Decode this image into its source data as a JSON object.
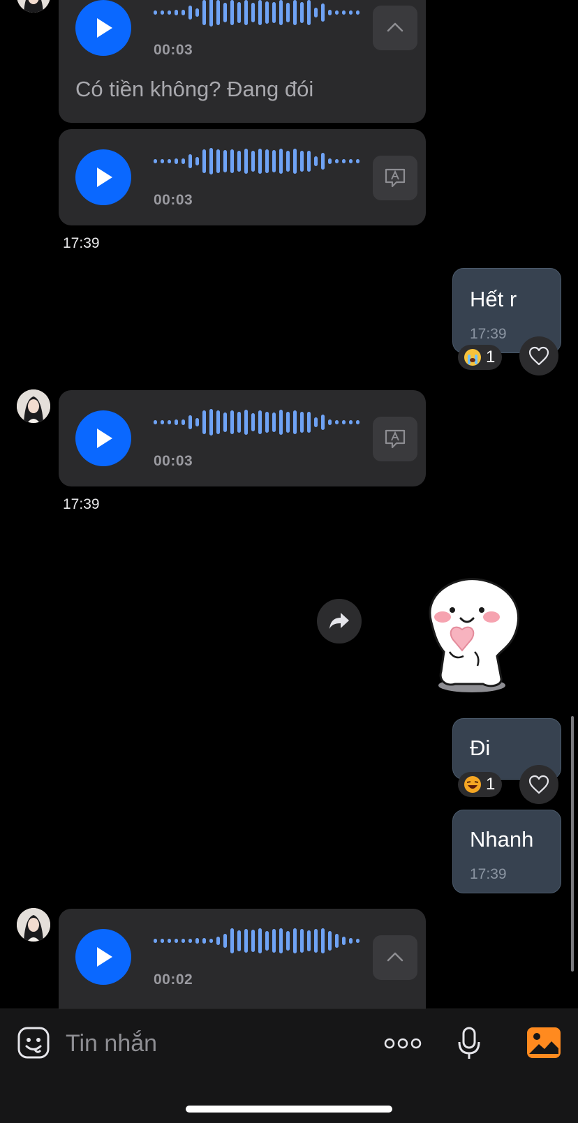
{
  "messages": [
    {
      "type": "voice-in",
      "duration": "00:03",
      "transcript": "Có tiền không? Đang đói",
      "action_icon": "chevron-up-icon"
    },
    {
      "type": "voice-in",
      "duration": "00:03",
      "action_icon": "transcribe-icon"
    },
    {
      "type": "time",
      "value": "17:39"
    },
    {
      "type": "text-out",
      "text": "Hết r",
      "time": "17:39",
      "reaction": {
        "emoji": "crying-face",
        "count": "1"
      }
    },
    {
      "type": "voice-in",
      "duration": "00:03",
      "action_icon": "transcribe-icon"
    },
    {
      "type": "time",
      "value": "17:39"
    },
    {
      "type": "sticker-out",
      "sticker": "white-mascot-holding-heart"
    },
    {
      "type": "text-out",
      "text": "Đi",
      "reaction": {
        "emoji": "laughing-face",
        "count": "1"
      }
    },
    {
      "type": "text-out",
      "text": "Nhanh",
      "time": "17:39"
    },
    {
      "type": "voice-in",
      "duration": "00:02",
      "action_icon": "chevron-up-icon"
    }
  ],
  "composer": {
    "placeholder": "Tin nhắn",
    "icons": [
      "sticker-icon",
      "more-icon",
      "microphone-icon",
      "photo-icon"
    ]
  },
  "colors": {
    "play": "#0a68ff",
    "wave": "#6fa3f5",
    "outgoing_bubble": "#374250",
    "incoming_card": "#2a2a2c",
    "photo_icon": "#ff8a1f"
  }
}
